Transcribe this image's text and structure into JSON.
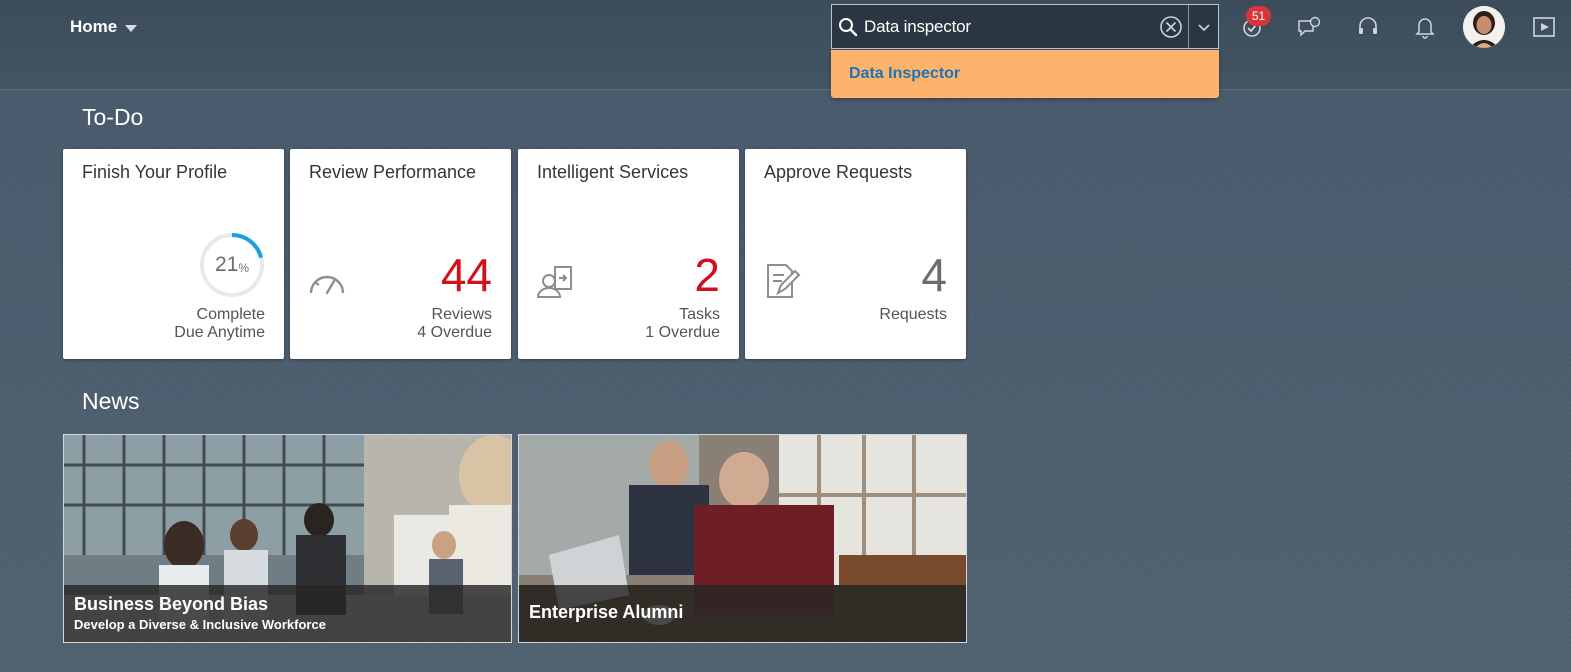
{
  "header": {
    "home_label": "Home",
    "search": {
      "value": "Data inspector",
      "placeholder": ""
    },
    "suggestion": "Data Inspector",
    "todo_badge": "51",
    "icons": [
      "search-icon",
      "clear-icon",
      "chevron-down-icon",
      "todo-check-icon",
      "feedback-icon",
      "support-headset-icon",
      "bell-icon",
      "avatar",
      "play-icon"
    ]
  },
  "todo": {
    "title": "To-Do",
    "tiles": [
      {
        "title": "Finish Your Profile",
        "value": "21",
        "unit": "%",
        "progress": 0.21,
        "line1": "Complete",
        "line2": "Due Anytime",
        "color": "#1a9fe0"
      },
      {
        "title": "Review Performance",
        "value": "44",
        "line1": "Reviews",
        "line2": "4 Overdue",
        "icon": "speedometer-icon",
        "color": "#d0111b"
      },
      {
        "title": "Intelligent Services",
        "value": "2",
        "line1": "Tasks",
        "line2": "1 Overdue",
        "icon": "employee-transfer-icon",
        "color": "#d0111b"
      },
      {
        "title": "Approve Requests",
        "value": "4",
        "line1": "Requests",
        "line2": "",
        "icon": "document-sign-icon",
        "color": "#6a6d70"
      }
    ]
  },
  "news": {
    "title": "News",
    "items": [
      {
        "headline": "Business Beyond Bias",
        "subtitle": "Develop a Diverse & Inclusive Workforce"
      },
      {
        "headline": "Enterprise Alumni",
        "subtitle": ""
      }
    ]
  }
}
